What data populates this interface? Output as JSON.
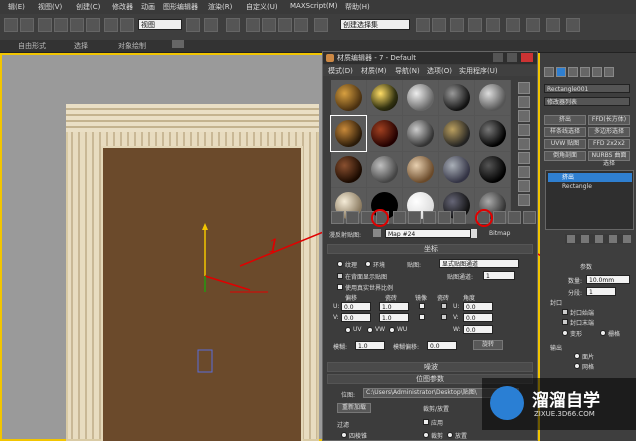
{
  "menubar": {
    "items": [
      "辑(E)",
      "视图(V)",
      "创建(C)",
      "修改器",
      "动画",
      "图形编辑器",
      "渲染(R)",
      "自定义(U)",
      "MAXScript(M)",
      "帮助(H)"
    ]
  },
  "toolbar": {
    "view_dropdown": "视图",
    "selection_set_placeholder": "创建选择集",
    "ribbon_items": [
      "自由形式",
      "选择",
      "对象绘制"
    ]
  },
  "material_editor": {
    "title": "材质编辑器 - 7 - Default",
    "menu": [
      "模式(D)",
      "材质(M)",
      "导航(N)",
      "选项(O)",
      "实用程序(U)"
    ],
    "map_label": "漫反射贴图:",
    "map_name": "Map #24",
    "map_type": "Bitmap",
    "coords_rollout": "坐标",
    "texture_radio": "纹理",
    "environ_radio": "环境",
    "mapping_label": "贴图:",
    "mapping_value": "显式贴图通道",
    "show_on_back": "在背面显示贴图",
    "map_channel_label": "贴图通道:",
    "map_channel_value": "1",
    "real_world": "使用真实世界比例",
    "col_offset": "偏移",
    "col_tiling": "瓷砖",
    "col_mirror": "镜像",
    "col_tile": "瓷砖",
    "col_angle": "角度",
    "u_label": "U:",
    "v_label": "V:",
    "w_label": "W:",
    "u_offset": "0.0",
    "u_tiling": "1.0",
    "u_angle": "0.0",
    "v_offset": "0.0",
    "v_tiling": "1.0",
    "v_angle": "0.0",
    "w_angle": "0.0",
    "uv_options": [
      "UV",
      "VW",
      "WU"
    ],
    "blur_label": "模糊:",
    "blur_value": "1.0",
    "blur_offset_label": "模糊偏移:",
    "blur_offset_value": "0.0",
    "rotate_button": "旋转",
    "noise_rollout": "噪波",
    "bitmap_params_rollout": "位图参数",
    "bitmap_label": "位图:",
    "bitmap_path": "C:\\Users\\Administrator\\Desktop\\贴图\\",
    "reload_button": "重新加载",
    "crop_label": "裁剪/放置",
    "apply_label": "应用",
    "filter_label": "过滤",
    "four_corner": "四棱锥",
    "crop_radio": "裁剪",
    "place_radio": "放置"
  },
  "command_panel": {
    "object_name": "Rectangle001",
    "modifier_list": "修改器列表",
    "buttons": [
      "挤出",
      "FFD(长方体)",
      "样条线选择",
      "多边形选择",
      "UVW 贴图",
      "FFD 2x2x2",
      "倒角剖面",
      "NURBS 曲面选择"
    ],
    "stack_items": [
      "挤出",
      "Rectangle"
    ],
    "params_title": "参数",
    "amount_label": "数量:",
    "amount_value": "10.0mm",
    "segments_label": "分段:",
    "segments_value": "1",
    "cap_label": "封口",
    "cap_start": "封口始端",
    "cap_end": "封口末端",
    "morph": "变形",
    "grid": "栅格",
    "output_label": "输出",
    "patch": "面片",
    "mesh": "网格"
  },
  "annotations": {
    "num1": "1",
    "num2": "2"
  },
  "watermark": {
    "brand": "溜溜自学",
    "url": "ZIXUE.3D66.COM"
  },
  "colors": {
    "highlight": "#e00000",
    "viewport_border": "#f2c500"
  }
}
